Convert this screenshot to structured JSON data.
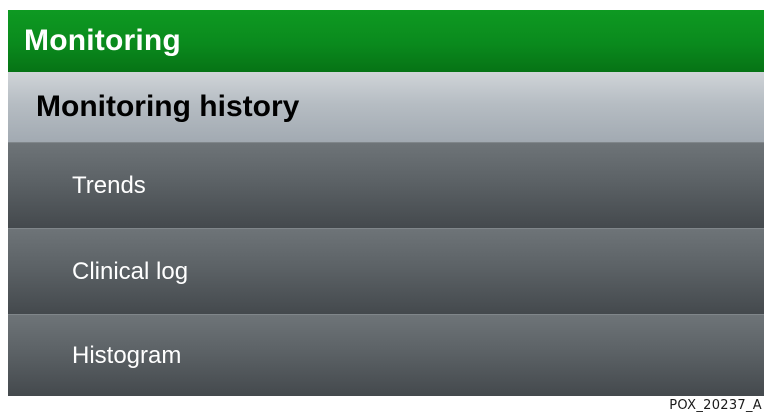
{
  "header": {
    "title": "Monitoring"
  },
  "section": {
    "title": "Monitoring history"
  },
  "menu": {
    "items": [
      {
        "label": "Trends"
      },
      {
        "label": "Clinical log"
      },
      {
        "label": "Histogram"
      }
    ]
  },
  "footer": {
    "figure_code": "POX_20237_A"
  },
  "colors": {
    "title_bar": "#0a8a1d",
    "section_header": "#b6bdc3",
    "menu_item": "#5c6266"
  }
}
